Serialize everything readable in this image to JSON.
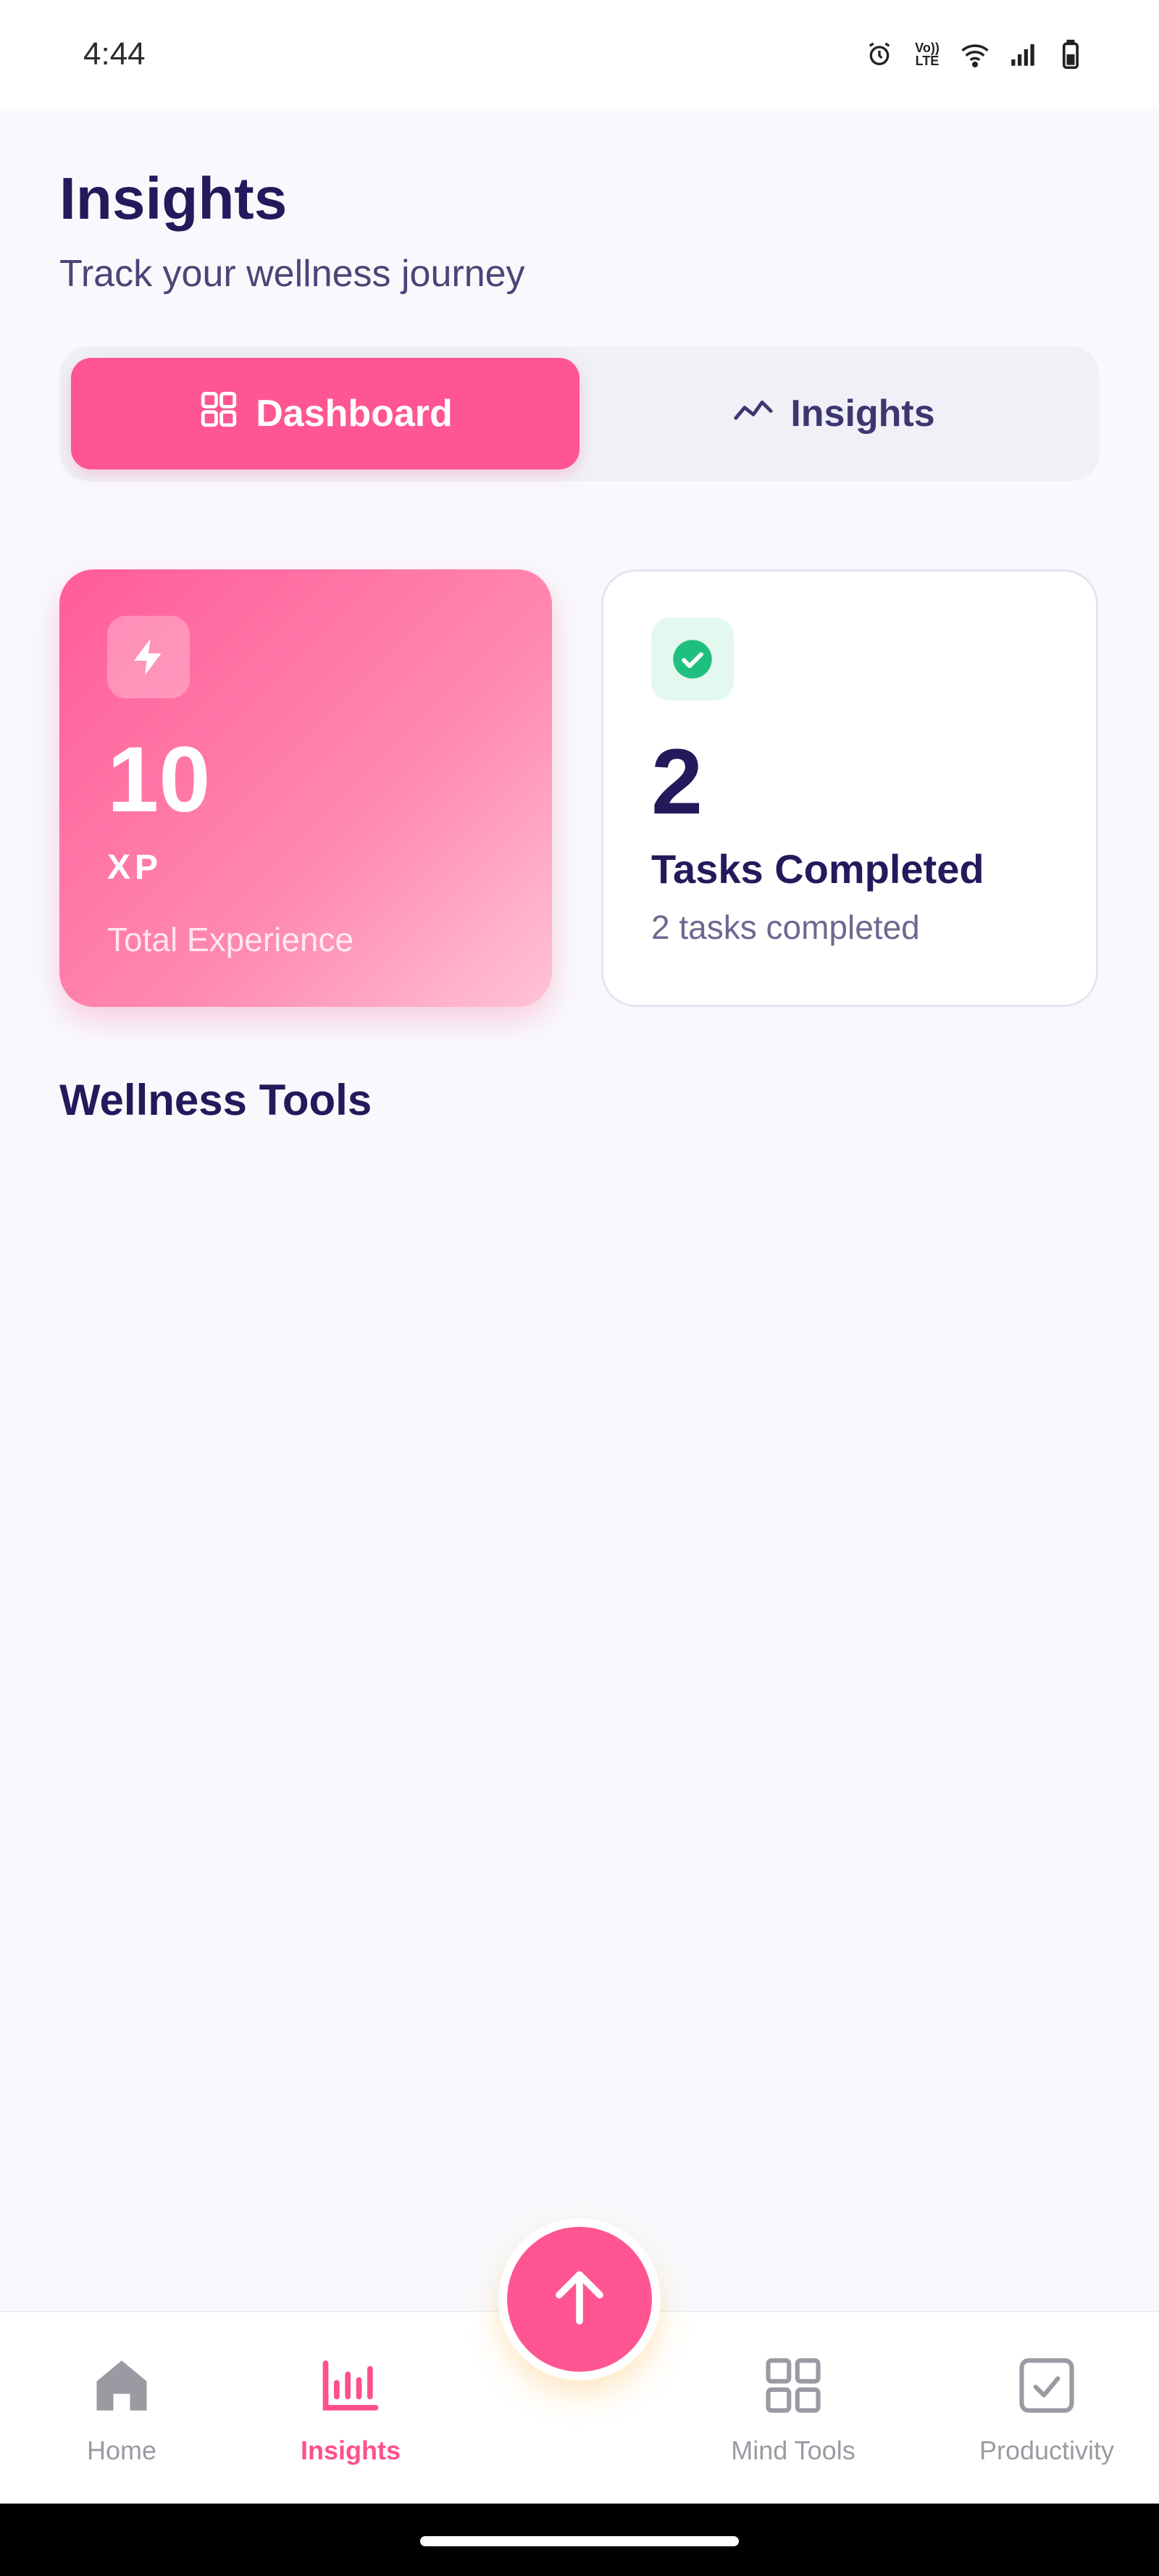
{
  "status_bar": {
    "time": "4:44",
    "lte_top": "Vo))",
    "lte_bottom": "LTE"
  },
  "header": {
    "title": "Insights",
    "subtitle": "Track your wellness journey"
  },
  "tabs": [
    {
      "label": "Dashboard",
      "active": true
    },
    {
      "label": "Insights",
      "active": false
    }
  ],
  "stats": {
    "xp": {
      "value": "10",
      "unit": "XP",
      "caption": "Total Experience"
    },
    "tasks": {
      "value": "2",
      "heading": "Tasks Completed",
      "caption": "2 tasks completed"
    }
  },
  "section_title": "Wellness Tools",
  "bottom_nav": [
    {
      "label": "Home",
      "icon": "home-icon",
      "active": false
    },
    {
      "label": "Insights",
      "icon": "bar-chart-icon",
      "active": true
    },
    {
      "label": "Mind Tools",
      "icon": "grid-icon",
      "active": false
    },
    {
      "label": "Productivity",
      "icon": "checkbox-icon",
      "active": false
    }
  ],
  "fab": {
    "icon": "arrow-up-icon"
  },
  "colors": {
    "accent": "#ff5592",
    "title": "#231a5c",
    "success": "#1fc07f"
  }
}
